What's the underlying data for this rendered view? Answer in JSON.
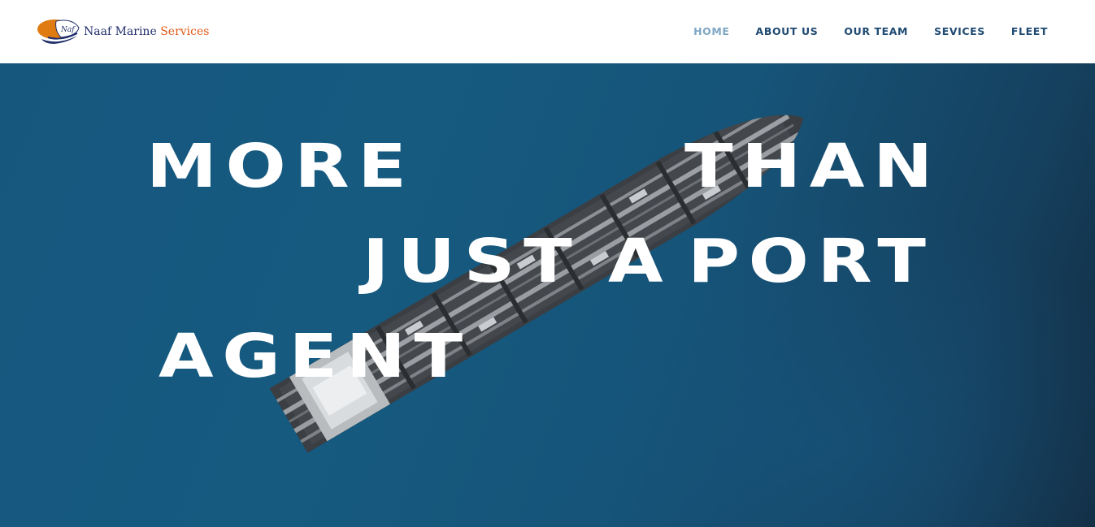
{
  "brand": {
    "name_main": "Naaf Marine",
    "name_accent": "Services",
    "logo_monogram": "Naf"
  },
  "nav": {
    "items": [
      {
        "label": "HOME",
        "active": true
      },
      {
        "label": "ABOUT US",
        "active": false
      },
      {
        "label": "OUR TEAM",
        "active": false
      },
      {
        "label": "SEVICES",
        "active": false
      },
      {
        "label": "FLEET",
        "active": false
      }
    ]
  },
  "hero": {
    "words": [
      "MORE",
      "THAN",
      "JUST",
      "A",
      "PORT",
      "AGENT"
    ],
    "image": "tanker-ship-aerial"
  },
  "colors": {
    "nav_text": "#1f4a72",
    "nav_active": "#7fa7c4",
    "hero_bg": "#16577e",
    "brand_navy": "#1f2d6b",
    "brand_orange": "#e05a1a"
  }
}
